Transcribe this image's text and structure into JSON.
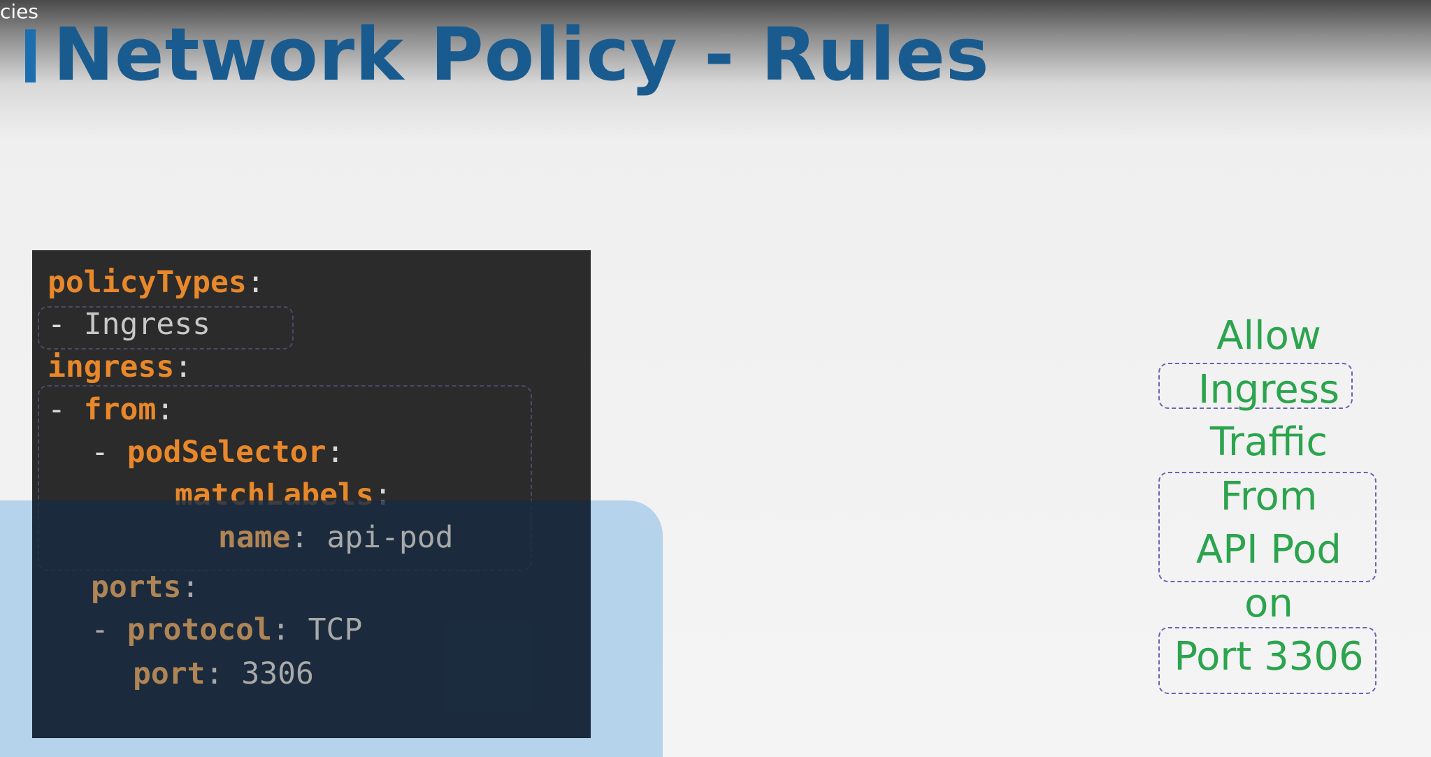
{
  "window": {
    "corner_label": "cies"
  },
  "slide": {
    "title": "Network Policy - Rules",
    "accent_color": "#1b6fae",
    "title_color": "#1a5b8f"
  },
  "code": {
    "lines": {
      "l1": {
        "key": "policyTypes",
        "sep": ":"
      },
      "l2": {
        "dash": "- ",
        "value": "Ingress"
      },
      "l3": {
        "key": "ingress",
        "sep": ":"
      },
      "l4": {
        "dash": "- ",
        "key": "from",
        "sep": ":"
      },
      "l5": {
        "dash": "- ",
        "key": "podSelector",
        "sep": ":"
      },
      "l6": {
        "key": "matchLabels",
        "sep": ":"
      },
      "l7": {
        "key": "name",
        "sep": ": ",
        "value": "api-pod"
      },
      "l8": {
        "key": "ports",
        "sep": ":"
      },
      "l9": {
        "dash": "- ",
        "key": "protocol",
        "sep": ": ",
        "value": "TCP"
      },
      "l10": {
        "key": "port",
        "sep": ": ",
        "value": "3306"
      }
    },
    "key_color": "#e8882a",
    "background": "#2b2b2b"
  },
  "explanation": {
    "words": [
      "Allow",
      "Ingress",
      "Traffic",
      "From",
      "API Pod",
      "on",
      "Port 3306"
    ],
    "color": "#2ca44e"
  }
}
